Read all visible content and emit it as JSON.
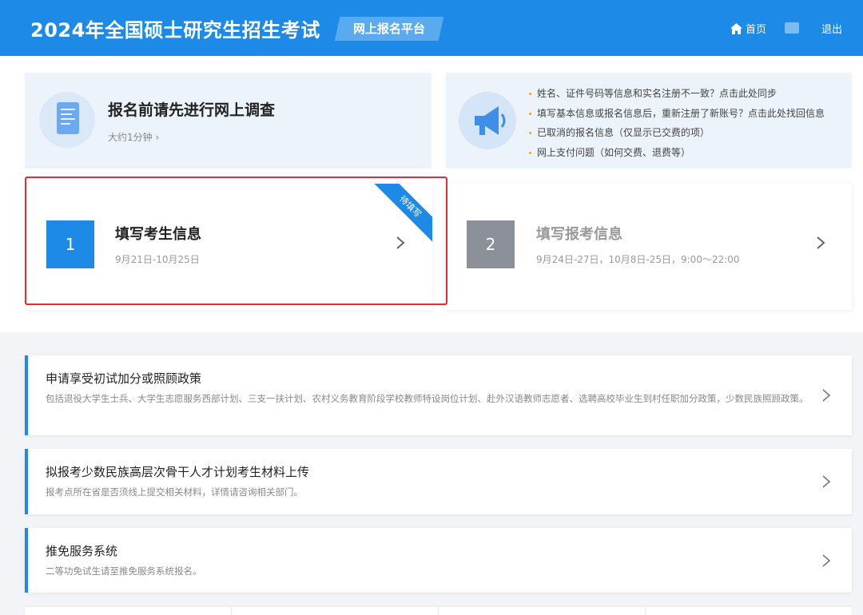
{
  "header": {
    "title": "2024年全国硕士研究生招生考试",
    "platform": "网上报名平台",
    "home_label": "首页",
    "logout_label": "退出"
  },
  "survey": {
    "title": "报名前请先进行网上调查",
    "subtitle": "大约1分钟 ›"
  },
  "notices": [
    "姓名、证件号码等信息和实名注册不一致？点击此处同步",
    "填写基本信息或报名信息后，重新注册了新账号？点击此处找回信息",
    "已取消的报名信息（仅显示已交费的项）",
    "网上支付问题（如何交费、退费等）"
  ],
  "steps": [
    {
      "number": "1",
      "title": "填写考生信息",
      "date": "9月21日-10月25日",
      "ribbon": "待填写",
      "status": "active"
    },
    {
      "number": "2",
      "title": "填写报考信息",
      "date": "9月24日-27日，10月8日-25日，9:00～22:00",
      "status": "inactive"
    }
  ],
  "list_items": [
    {
      "title": "申请享受初试加分或照顾政策",
      "description": "包括退役大学生士兵、大学生志愿服务西部计划、三支一扶计划、农村义务教育阶段学校教师特设岗位计划、赴外汉语教师志愿者、选聘高校毕业生到村任职加分政策，少数民族照顾政策。"
    },
    {
      "title": "拟报考少数民族高层次骨干人才计划考生材料上传",
      "description": "报考点所在省是否须线上提交相关材料，详情请咨询相关部门。"
    },
    {
      "title": "推免服务系统",
      "description": "二等功免试生请至推免服务系统报名。"
    }
  ],
  "colors": {
    "brand_blue": "#1c8ae6",
    "highlight_red": "#e52d2d",
    "inactive_gray": "#8b9099"
  },
  "icons": {
    "home": "home-icon",
    "survey": "document-icon",
    "notice": "megaphone-icon",
    "chevron": "chevron-right-icon"
  }
}
